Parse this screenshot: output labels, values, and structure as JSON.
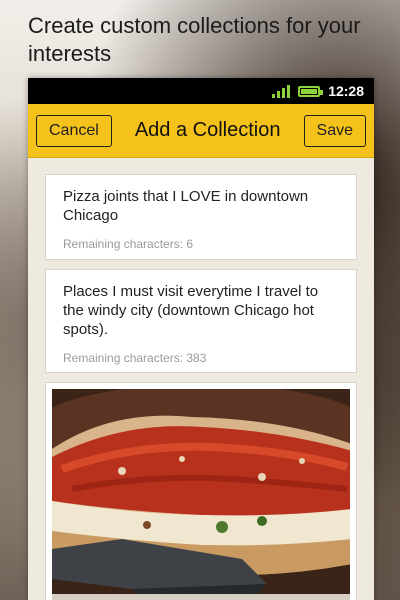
{
  "promo": {
    "headline": "Create custom collections for your interests"
  },
  "status_bar": {
    "time": "12:28",
    "signal_icon": "signal-icon",
    "battery_icon": "battery-icon"
  },
  "action_bar": {
    "cancel_label": "Cancel",
    "title": "Add a Collection",
    "save_label": "Save",
    "color": "#f4c21a"
  },
  "fields": [
    {
      "text": "Pizza joints that I LOVE in downtown Chicago",
      "remaining": "Remaining characters: 6"
    },
    {
      "text": "Places I must visit everytime I travel to the windy city (downtown Chicago hot spots).",
      "remaining": "Remaining characters: 383"
    }
  ],
  "photo": {
    "subject": "deep-dish pizza"
  }
}
